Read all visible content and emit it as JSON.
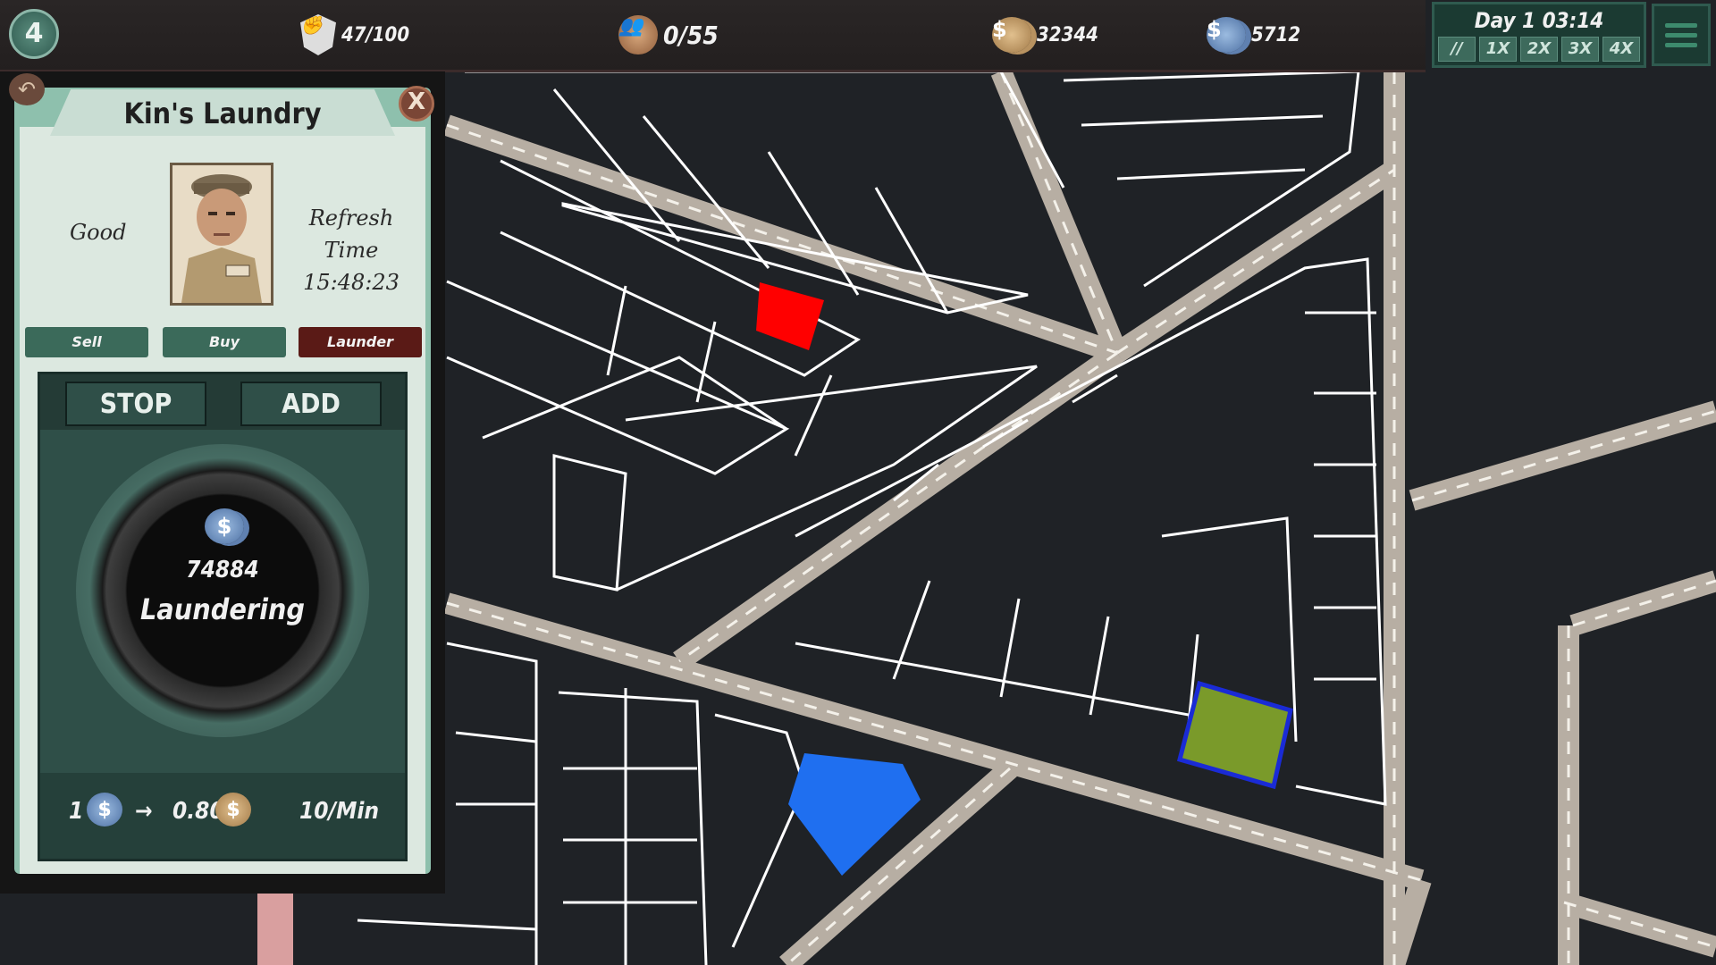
{
  "hud": {
    "level": "4",
    "influence": "47/100",
    "crew": "0/55",
    "clean_cash": "32344",
    "dirty_cash": "5712",
    "day_time": "Day 1 03:14",
    "speeds": [
      "//",
      "1X",
      "2X",
      "3X",
      "4X"
    ],
    "icons": {
      "influence": "fist-badge-icon",
      "crew": "people-icon",
      "clean_cash": "gold-coin-icon",
      "dirty_cash": "blue-coin-icon",
      "menu": "hamburger-menu-icon"
    }
  },
  "business": {
    "name": "Kin's Laundry",
    "quality": "Good",
    "refresh_label": "Refresh Time",
    "refresh_time": "15:48:23",
    "tabs": [
      "Sell",
      "Buy",
      "Launder"
    ],
    "active_tab": "Launder",
    "stop_label": "STOP",
    "add_label": "ADD",
    "laundering_amount": "74884",
    "status": "Laundering",
    "rate_in": "1",
    "rate_out": "0.80",
    "rate_arrow": "→",
    "speed": "10/Min",
    "close_label": "X"
  },
  "map": {
    "highlighted_lots": [
      {
        "name": "red-lot",
        "color": "#ff0000"
      },
      {
        "name": "green-lot",
        "color": "#7a9a2a"
      },
      {
        "name": "blue-lot",
        "color": "#1f6ff0"
      }
    ]
  },
  "colors": {
    "background": "#1f2226",
    "road": "#b7aea3",
    "panel_green": "#8ec0ad",
    "active_tab": "#5a1a16"
  }
}
